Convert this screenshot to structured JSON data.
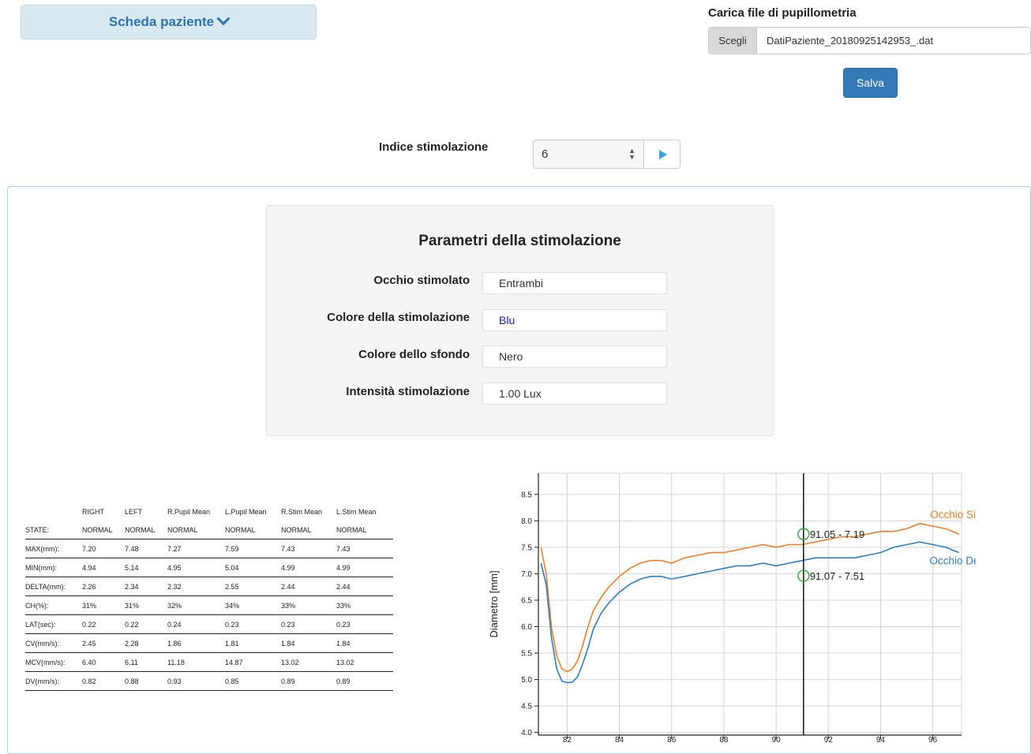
{
  "header": {
    "patient_button": "Scheda paziente",
    "upload_title": "Carica file di pupillometria",
    "file_choose": "Scegli",
    "file_name": "DatiPaziente_20180925142953_.dat",
    "save": "Salva"
  },
  "stimulation": {
    "label": "Indice stimolazione",
    "selected": "6"
  },
  "params": {
    "title": "Parametri della stimolazione",
    "rows": [
      {
        "label": "Occhio stimolato",
        "value": "Entrambi"
      },
      {
        "label": "Colore della stimolazione",
        "value": "Blu"
      },
      {
        "label": "Colore dello sfondo",
        "value": "Nero"
      },
      {
        "label": "Intensità stimolazione",
        "value": "1.00 Lux"
      }
    ],
    "colors": {
      "blu_text": "#1a1aa6"
    }
  },
  "table": {
    "headers": [
      "",
      "RIGHT",
      "LEFT",
      "R.Pupil Mean",
      "L.Pupil Mean",
      "R.Stim Mean",
      "L.Stim Mean"
    ],
    "rows": [
      [
        "STATE:",
        "NORMAL",
        "NORMAL",
        "NORMAL",
        "NORMAL",
        "NORMAL",
        "NORMAL"
      ],
      [
        "MAX(mm):",
        "7.20",
        "7.48",
        "7.27",
        "7.59",
        "7.43",
        "7.43"
      ],
      [
        "MIN(mm):",
        "4.94",
        "5.14",
        "4.95",
        "5.04",
        "4.99",
        "4.99"
      ],
      [
        "DELTA(mm):",
        "2.26",
        "2.34",
        "2.32",
        "2.55",
        "2.44",
        "2.44"
      ],
      [
        "CH(%):",
        "31%",
        "31%",
        "32%",
        "34%",
        "33%",
        "33%"
      ],
      [
        "LAT(sec):",
        "0.22",
        "0.22",
        "0.24",
        "0.23",
        "0.23",
        "0.23"
      ],
      [
        "CV(mm/s):",
        "2.45",
        "2.28",
        "1.86",
        "1.81",
        "1.84",
        "1.84"
      ],
      [
        "MCV(mm/s):",
        "6.40",
        "6.11",
        "11.18",
        "14.87",
        "13.02",
        "13.02"
      ],
      [
        "DV(mm/s):",
        "0.82",
        "0.88",
        "0.93",
        "0.85",
        "0.89",
        "0.89"
      ]
    ]
  },
  "chart_data": {
    "type": "line",
    "ylabel": "Diametro [mm]",
    "xlim": [
      80.9,
      97.1
    ],
    "ylim": [
      3.95,
      8.9
    ],
    "x_ticks": [
      82,
      84,
      86,
      88,
      90,
      92,
      94,
      96
    ],
    "y_ticks": [
      4.0,
      4.5,
      5.0,
      5.5,
      6.0,
      6.5,
      7.0,
      7.5,
      8.0,
      8.5
    ],
    "grid": true,
    "cursor_x": 91.05,
    "series": [
      {
        "name": "Occhio Sinistro",
        "color": "#f07f25",
        "x": [
          81.0,
          81.2,
          81.4,
          81.6,
          81.8,
          82.0,
          82.2,
          82.4,
          82.6,
          82.8,
          83.0,
          83.3,
          83.6,
          84.0,
          84.4,
          84.8,
          85.2,
          85.6,
          86.0,
          86.5,
          87.0,
          87.5,
          88.0,
          88.5,
          89.0,
          89.5,
          90.0,
          90.5,
          91.0,
          91.5,
          92.0,
          92.5,
          93.0,
          93.5,
          94.0,
          94.5,
          95.0,
          95.5,
          96.0,
          96.5,
          97.0
        ],
        "y": [
          7.5,
          7.0,
          6.0,
          5.45,
          5.2,
          5.15,
          5.2,
          5.35,
          5.65,
          6.0,
          6.3,
          6.55,
          6.75,
          6.95,
          7.1,
          7.2,
          7.25,
          7.25,
          7.2,
          7.3,
          7.35,
          7.4,
          7.4,
          7.45,
          7.5,
          7.55,
          7.5,
          7.55,
          7.55,
          7.6,
          7.65,
          7.7,
          7.7,
          7.75,
          7.8,
          7.8,
          7.85,
          7.95,
          7.9,
          7.85,
          7.75
        ]
      },
      {
        "name": "Occhio Destro",
        "color": "#2d7fc1",
        "x": [
          81.0,
          81.2,
          81.4,
          81.6,
          81.8,
          82.0,
          82.2,
          82.4,
          82.6,
          82.8,
          83.0,
          83.3,
          83.6,
          84.0,
          84.4,
          84.8,
          85.2,
          85.6,
          86.0,
          86.5,
          87.0,
          87.5,
          88.0,
          88.5,
          89.0,
          89.5,
          90.0,
          90.5,
          91.0,
          91.5,
          92.0,
          92.5,
          93.0,
          93.5,
          94.0,
          94.5,
          95.0,
          95.5,
          96.0,
          96.5,
          97.0
        ],
        "y": [
          7.2,
          6.8,
          5.8,
          5.2,
          4.97,
          4.94,
          4.95,
          5.05,
          5.3,
          5.6,
          5.95,
          6.25,
          6.45,
          6.65,
          6.8,
          6.9,
          6.95,
          6.95,
          6.9,
          6.95,
          7.0,
          7.05,
          7.1,
          7.15,
          7.15,
          7.2,
          7.15,
          7.2,
          7.25,
          7.3,
          7.3,
          7.3,
          7.3,
          7.35,
          7.4,
          7.5,
          7.55,
          7.6,
          7.55,
          7.5,
          7.4
        ]
      }
    ],
    "annotations": [
      "91.05 - 7.19",
      "91.07 - 7.51"
    ]
  }
}
